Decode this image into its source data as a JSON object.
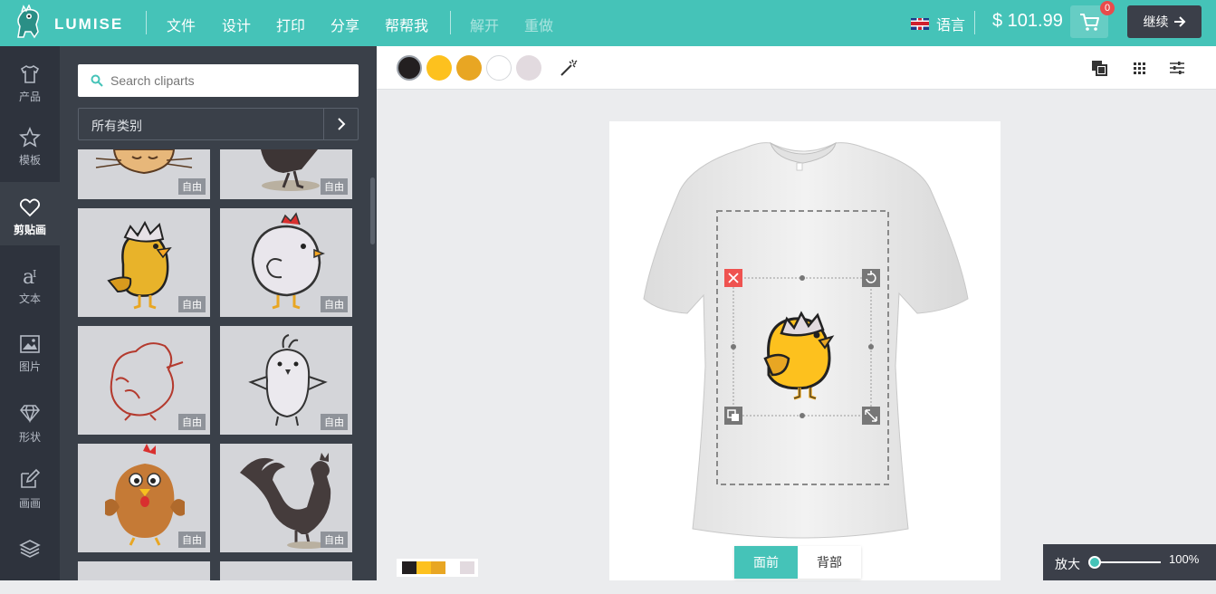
{
  "app": {
    "brand": "LUMISE"
  },
  "topbar": {
    "menu": [
      {
        "label": "文件",
        "enabled": true
      },
      {
        "label": "设计",
        "enabled": true
      },
      {
        "label": "打印",
        "enabled": true
      },
      {
        "label": "分享",
        "enabled": true
      },
      {
        "label": "帮帮我",
        "enabled": true
      },
      {
        "label": "解开",
        "enabled": false
      },
      {
        "label": "重做",
        "enabled": false
      }
    ],
    "language_label": "语言",
    "price": "$ 101.99",
    "cart_count": "0",
    "continue_label": "继续"
  },
  "leftnav": {
    "items": [
      {
        "label": "产品",
        "icon": "tshirt-icon"
      },
      {
        "label": "模板",
        "icon": "star-icon"
      },
      {
        "label": "剪贴画",
        "icon": "heart-icon",
        "active": true
      },
      {
        "label": "文本",
        "icon": "text-icon"
      },
      {
        "label": "图片",
        "icon": "image-icon"
      },
      {
        "label": "形状",
        "icon": "diamond-icon"
      },
      {
        "label": "画画",
        "icon": "pencil-icon"
      },
      {
        "label": "",
        "icon": "layers-icon"
      }
    ]
  },
  "panel": {
    "search_placeholder": "Search cliparts",
    "category": "所有类别",
    "tile_tag": "自由"
  },
  "toolbar": {
    "colors": [
      "#231f20",
      "#fdc11e",
      "#e8a623",
      "#ffffff",
      "#e2dadf"
    ]
  },
  "stage": {
    "views": [
      "面前",
      "背部"
    ],
    "active_view": "面前"
  },
  "zoom": {
    "label": "放大",
    "value": "100%"
  },
  "palette": {
    "colors": [
      "#231f20",
      "#fdc11e",
      "#e8a623",
      "#ffffff",
      "#e2dadf"
    ]
  }
}
